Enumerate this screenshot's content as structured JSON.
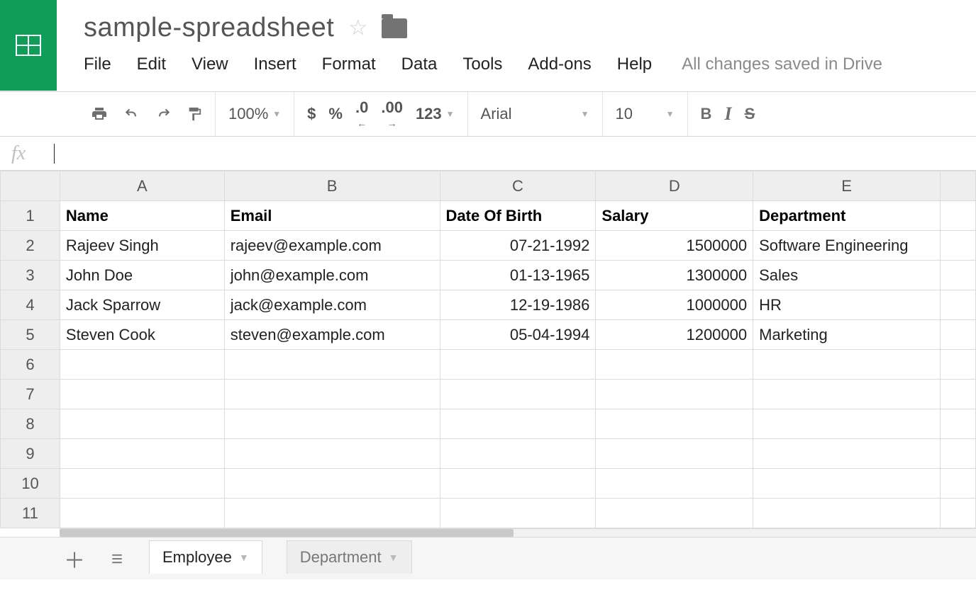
{
  "document": {
    "title": "sample-spreadsheet"
  },
  "menu": {
    "file": "File",
    "edit": "Edit",
    "view": "View",
    "insert": "Insert",
    "format": "Format",
    "data": "Data",
    "tools": "Tools",
    "addons": "Add-ons",
    "help": "Help",
    "save_status": "All changes saved in Drive"
  },
  "toolbar": {
    "zoom": "100%",
    "currency": "$",
    "percent": "%",
    "dec_less": ".0",
    "dec_more": ".00",
    "num_format": "123",
    "font": "Arial",
    "font_size": "10",
    "bold": "B",
    "italic": "I",
    "strike": "S"
  },
  "formula_bar": {
    "fx_label": "fx"
  },
  "columns": [
    "A",
    "B",
    "C",
    "D",
    "E"
  ],
  "row_numbers": [
    "1",
    "2",
    "3",
    "4",
    "5",
    "6",
    "7",
    "8",
    "9",
    "10",
    "11"
  ],
  "selected_row_index": 6,
  "table": {
    "headers": {
      "name": "Name",
      "email": "Email",
      "dob": "Date Of Birth",
      "salary": "Salary",
      "department": "Department"
    },
    "rows": [
      {
        "name": "Rajeev Singh",
        "email": "rajeev@example.com",
        "dob": "07-21-1992",
        "salary": "1500000",
        "department": "Software Engineering"
      },
      {
        "name": "John Doe",
        "email": "john@example.com",
        "dob": "01-13-1965",
        "salary": "1300000",
        "department": "Sales"
      },
      {
        "name": "Jack Sparrow",
        "email": "jack@example.com",
        "dob": "12-19-1986",
        "salary": "1000000",
        "department": "HR"
      },
      {
        "name": "Steven Cook",
        "email": "steven@example.com",
        "dob": "05-04-1994",
        "salary": "1200000",
        "department": "Marketing"
      }
    ]
  },
  "sheets": {
    "tab1": "Employee",
    "tab2": "Department"
  }
}
